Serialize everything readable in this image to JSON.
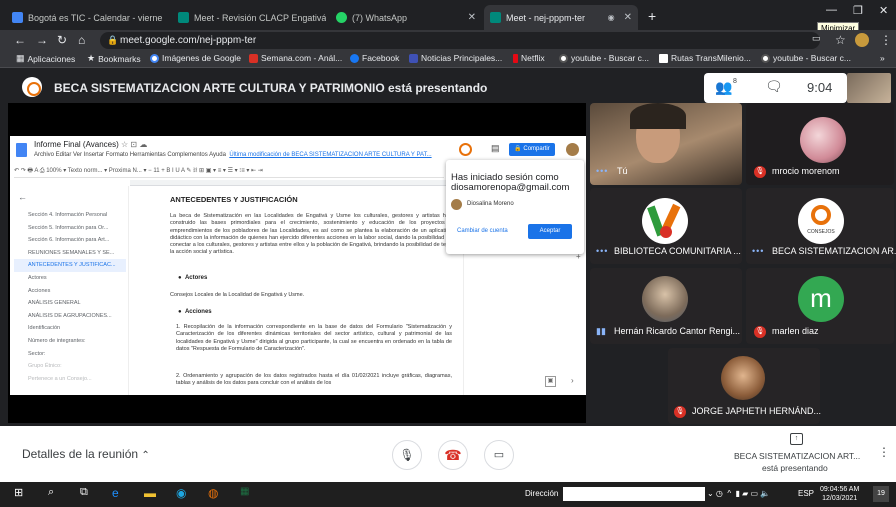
{
  "browser": {
    "tabs": [
      {
        "label": "Bogotá es TIC - Calendar - vierne",
        "color": "#4285f4"
      },
      {
        "label": "Meet - Revisión CLACP Engativá",
        "color": "#00897b"
      },
      {
        "label": "(7) WhatsApp",
        "color": "#25d366"
      },
      {
        "label": "Meet - nej-pppm-ter",
        "color": "#00897b"
      }
    ],
    "new_tab": "+",
    "close_glyph": "✕",
    "minimize_tooltip": "Minimizar",
    "url": "meet.google.com/nej-pppm-ter",
    "bookmarks": [
      {
        "label": "Aplicaciones",
        "color": "#e8eaed"
      },
      {
        "label": "Bookmarks",
        "color": "#e8eaed"
      },
      {
        "label": "Imágenes de Google",
        "color": "#4285f4"
      },
      {
        "label": "Semana.com - Anál...",
        "color": "#d93025"
      },
      {
        "label": "Facebook",
        "color": "#1877f2"
      },
      {
        "label": "Noticias Principales...",
        "color": "#3f51b5"
      },
      {
        "label": "Netflix",
        "color": "#e50914"
      },
      {
        "label": "youtube - Buscar c...",
        "color": "#ffffff"
      },
      {
        "label": "Rutas TransMilenio...",
        "color": "#ffffff"
      },
      {
        "label": "youtube - Buscar c...",
        "color": "#ffffff"
      }
    ],
    "bookmarks_more": "»"
  },
  "meet": {
    "presenting_title": "BECA SISTEMATIZACION ARTE CULTURA Y PATRIMONIO está presentando",
    "clock": "9:04",
    "participants_badge": "8",
    "you_label": "Tú",
    "participants": [
      {
        "name": "Tú"
      },
      {
        "name": "mrocio morenom"
      },
      {
        "name": "BIBLIOTECA COMUNITARIA ..."
      },
      {
        "name": "BECA SISTEMATIZACION AR..."
      },
      {
        "name": "Hernán Ricardo Cantor Rengi..."
      },
      {
        "name": "marlen diaz",
        "initial": "m"
      },
      {
        "name": "JORGE JAPHETH HERNÁND..."
      }
    ],
    "logo_caption": "CONSEJOS",
    "details_label": "Detalles de la reunión",
    "presenter_line1": "BECA SISTEMATIZACION ART...",
    "presenter_line2": "está presentando"
  },
  "doc": {
    "title": "Informe Final (Avances)",
    "menu": "Archivo  Editar  Ver  Insertar  Formato  Herramientas  Complementos  Ayuda",
    "last_edit": "Última modificación de BECA SISTEMATIZACION ARTE CULTURA Y PAT...",
    "toolbar": "↶  ↷  🖶  A  ⎙   100%  ▾   Texto norm...  ▾   Proxima N...  ▾   −  11  +   B  I  U  A  ✎    ⛓  ⊞  ▣  ▾   ≡  ▾   ☰  ▾   ⁝≡  ▾   ⇤  ⇥",
    "share_label": "Compartir",
    "outline": [
      "Sección 4. Información Personal",
      "Sección 5. Información para Or...",
      "Sección 6. Información para Art...",
      "REUNIONES SEMANALES Y SE...",
      "ANTECEDENTES Y JUSTIFICAC...",
      "Actores",
      "Acciones",
      "ANÁLISIS GENERAL",
      "ANÁLISIS DE AGRUPACIONES...",
      "Identificación",
      "Número de integrantes:",
      "Sector:",
      "Grupo Étnico:",
      "Pertenece a un Consejo..."
    ],
    "outline_active_index": 4,
    "heading": "ANTECEDENTES Y JUSTIFICACIÓN",
    "para1": "La beca de Sistematización en las Localidades de Engativá y Usme los culturales, gestores y artistas han construido las bases primordiales para el crecimiento, sostenimiento y educación de los proyectos y emprendimientos de los pobladores de las Localidades, es así como se plantea la elaboración de un aplicativo didáctico con la información de quienes han ejercido diferentes acciones en la labor social, dando la posibilidad de conectar a los culturales, gestores y artistas entre ellos y la población de Engativá, brindando la posibilidad de tejer la acción social y artística.",
    "bullet1": "Actores",
    "para2": "Consejos Locales de la Localidad de Engativá y Usme.",
    "bullet2": "Acciones",
    "para3": "1.  Recopilación de la información correspondiente en la base de datos del Formulario \"Sistematización y Caracterización de los diferentes dinámicas territoriales del sector artístico, cultural y patrimonial de las localidades de Engativá y Usme\" dirigida al grupo participante, la cual se encuentra en ordenado en la tabla de datos \"Respuesta de Formulario de Caracterización\".",
    "para4": "2.  Ordenamiento y agrupación de los datos registrados hasta el día 01/02/2021 incluye gráficas, diagramas, tablas y análisis de los datos para concluir con el análisis de los"
  },
  "popup": {
    "line1": "Has iniciado sesión como",
    "email": "diosamorenopa@gmail.com",
    "name": "Diosalina Moreno",
    "change": "Cambiar de cuenta",
    "accept": "Aceptar"
  },
  "taskbar": {
    "address_label": "Dirección",
    "lang": "ESP",
    "time": "09:04:56 AM",
    "date": "12/03/2021",
    "badge": "19"
  },
  "colors": {
    "meet_dark": "#202124",
    "end_call": "#d93025",
    "accent": "#1a73e8",
    "marlen_avatar": "#33a852"
  }
}
